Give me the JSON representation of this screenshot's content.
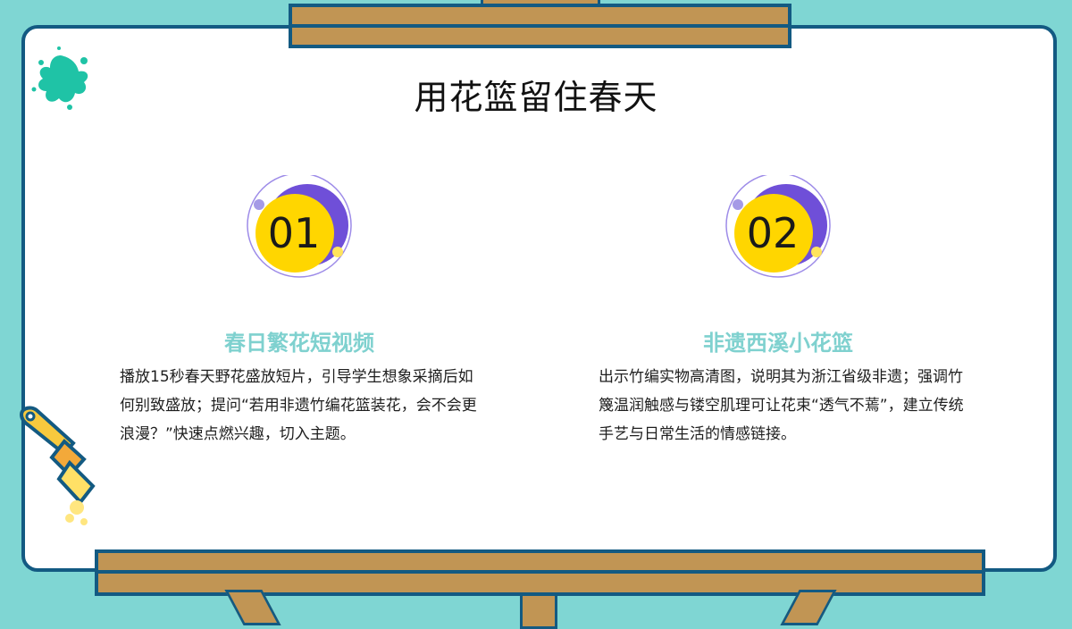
{
  "slide": {
    "title": "用花篮留住春天"
  },
  "items": [
    {
      "number": "01",
      "heading": "春日繁花短视频",
      "body": "播放15秒春天野花盛放短片，引导学生想象采摘后如何别致盛放；提问“若用非遗竹编花篮装花，会不会更浪漫？”快速点燃兴趣，切入主题。"
    },
    {
      "number": "02",
      "heading": "非遗西溪小花篮",
      "body": "出示竹编实物高清图，说明其为浙江省级非遗；强调竹篾温润触感与镂空肌理可让花束“透气不蔫”，建立传统手艺与日常生活的情感链接。"
    }
  ],
  "colors": {
    "background": "#7fd6d3",
    "board_border": "#135a82",
    "plank": "#c19554",
    "heading": "#7fd1cf",
    "badge_yellow": "#ffd600",
    "badge_purple": "#6f4fd8",
    "splash": "#1fc3a6"
  },
  "icons": [
    "paint-splash-icon",
    "paintbrush-icon"
  ]
}
